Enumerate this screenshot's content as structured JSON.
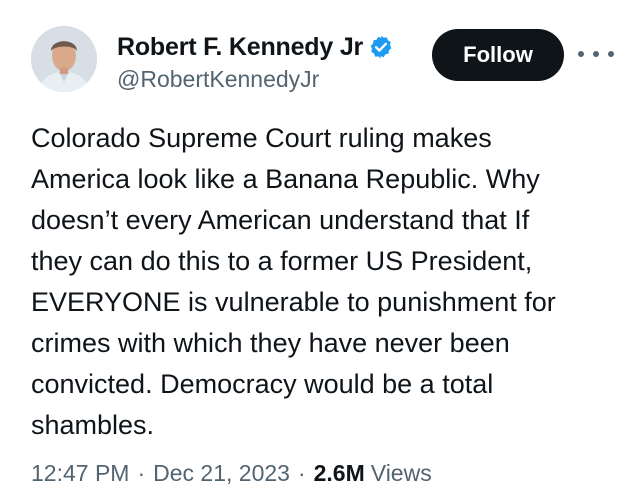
{
  "author": {
    "display_name": "Robert F. Kennedy Jr",
    "handle": "@RobertKennedyJr",
    "verified": true
  },
  "actions": {
    "follow_label": "Follow",
    "more_icon": "more-horizontal-icon"
  },
  "tweet": {
    "lines": [
      "Colorado Supreme Court ruling makes",
      "America look like a Banana Republic. Why",
      "doesn’t every American understand that If",
      "they can do this to a former US President,",
      "EVERYONE is vulnerable to punishment for",
      "crimes with which they have never been",
      "convicted. Democracy would be a total",
      "shambles."
    ]
  },
  "meta": {
    "time": "12:47 PM",
    "separator": "·",
    "date": "Dec 21, 2023",
    "views_count": "2.6M",
    "views_label": "Views"
  },
  "colors": {
    "text_primary": "#0f1419",
    "text_secondary": "#536471",
    "verified_blue": "#1d9bf0",
    "follow_bg": "#0f1419"
  }
}
